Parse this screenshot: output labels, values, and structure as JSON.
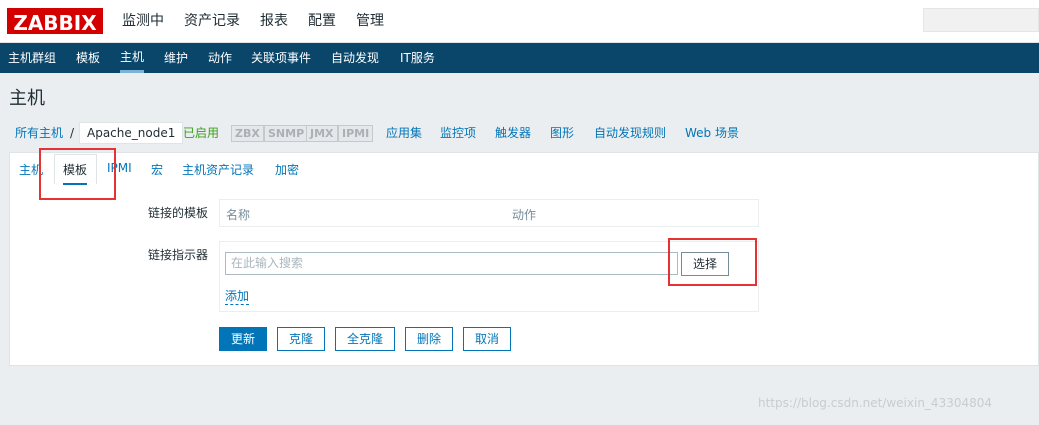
{
  "brand": {
    "logo": "ZABBIX"
  },
  "main_menu": [
    "监测中",
    "资产记录",
    "报表",
    "配置",
    "管理"
  ],
  "sub_menu": [
    "主机群组",
    "模板",
    "主机",
    "维护",
    "动作",
    "关联项事件",
    "自动发现",
    "IT服务"
  ],
  "sub_menu_active": "主机",
  "page_title": "主机",
  "breadcrumb": {
    "all_hosts": "所有主机",
    "separator": "/",
    "host": "Apache_node1",
    "status": "已启用",
    "badges": [
      "ZBX",
      "SNMP",
      "JMX",
      "IPMI"
    ],
    "links": [
      "应用集",
      "监控项",
      "触发器",
      "图形",
      "自动发现规则",
      "Web 场景"
    ]
  },
  "tabs": [
    "主机",
    "模板",
    "IPMI",
    "宏",
    "主机资产记录",
    "加密"
  ],
  "active_tab": "模板",
  "form": {
    "linked_templates_label": "链接的模板",
    "col_name": "名称",
    "col_action": "动作",
    "link_indicator_label": "链接指示器",
    "search_placeholder": "在此输入搜索",
    "select_button": "选择",
    "add_link": "添加"
  },
  "buttons": {
    "update": "更新",
    "clone": "克隆",
    "full_clone": "全克隆",
    "delete": "删除",
    "cancel": "取消"
  },
  "watermark": "https://blog.csdn.net/weixin_43304804",
  "colors": {
    "brand_red": "#d40000",
    "submenu_bg": "#0a466a",
    "link_blue": "#0275b8",
    "status_green": "#3c9e1a",
    "highlight_red": "#e53333"
  }
}
